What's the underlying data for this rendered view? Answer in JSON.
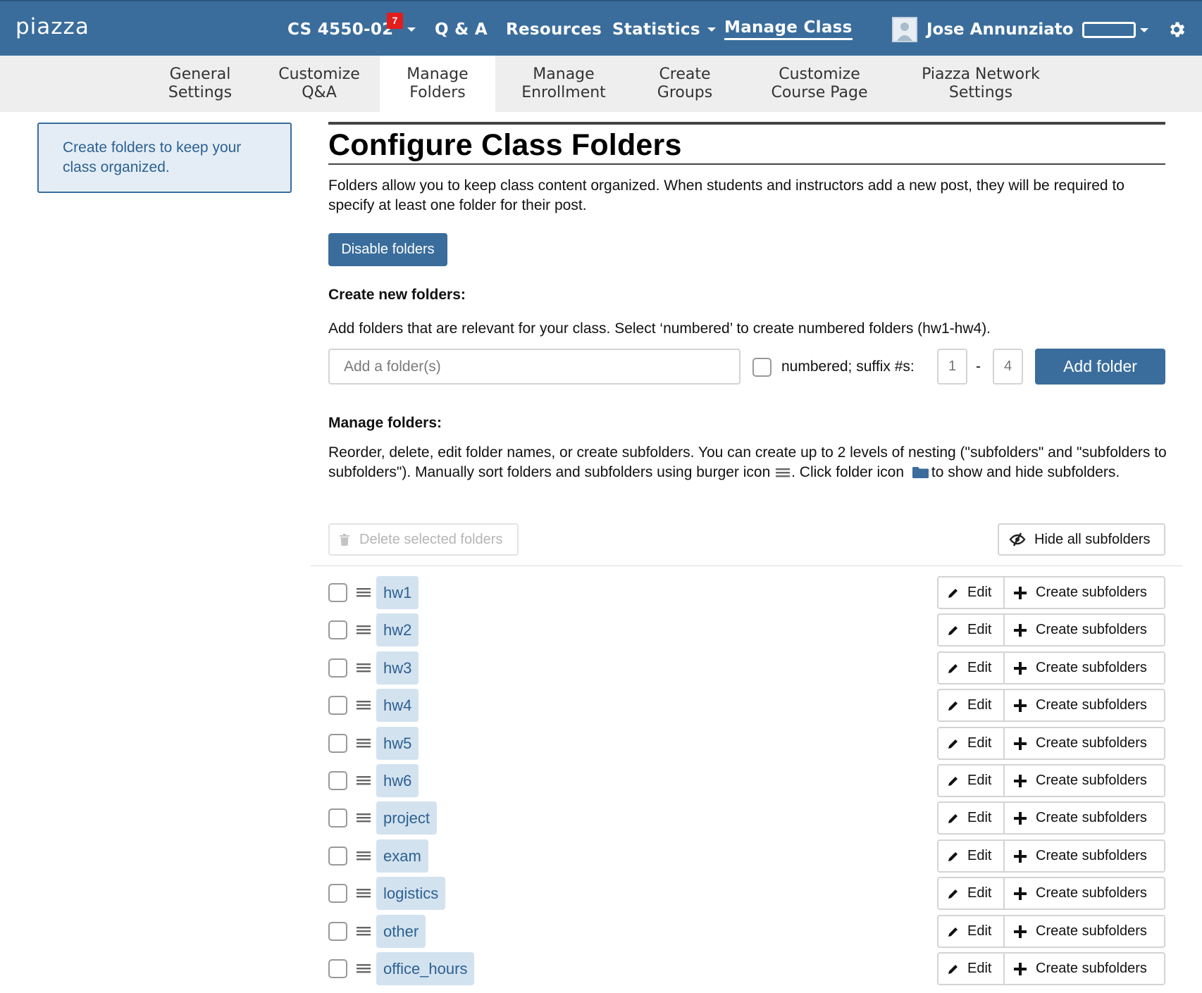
{
  "topbar": {
    "logo": "piazza",
    "class_name": "CS 4550-02",
    "class_badge": "7",
    "nav": {
      "qa": "Q & A",
      "resources": "Resources",
      "statistics": "Statistics",
      "manage_class": "Manage Class"
    },
    "user_name": "Jose Annunziato",
    "icons": [
      "caret-down-icon",
      "avatar-icon",
      "gear-icon"
    ]
  },
  "subnav": {
    "tabs": [
      {
        "line1": "General",
        "line2": "Settings",
        "active": false
      },
      {
        "line1": "Customize",
        "line2": "Q&A",
        "active": false
      },
      {
        "line1": "Manage",
        "line2": "Folders",
        "active": true
      },
      {
        "line1": "Manage",
        "line2": "Enrollment",
        "active": false
      },
      {
        "line1": "Create",
        "line2": "Groups",
        "active": false
      },
      {
        "line1": "Customize",
        "line2": "Course Page",
        "active": false
      },
      {
        "line1": "Piazza Network",
        "line2": "Settings",
        "active": false
      }
    ]
  },
  "sidebar": {
    "note": "Create folders to keep your class organized."
  },
  "main": {
    "title": "Configure Class Folders",
    "intro": "Folders allow you to keep class content organized. When students and instructors add a new post, they will be required to specify at least one folder for their post.",
    "disable_button": "Disable folders",
    "create": {
      "heading": "Create new folders:",
      "description": "Add folders that are relevant for your class. Select ‘numbered’ to create numbered folders (hw1-hw4).",
      "input_placeholder": "Add a folder(s)",
      "numbered_label": "numbered; suffix #s:",
      "suffix_from": "1",
      "suffix_dash": "-",
      "suffix_to": "4",
      "add_button": "Add folder"
    },
    "manage": {
      "heading": "Manage folders:",
      "desc_part1": "Reorder, delete, edit folder names, or create subfolders. You can create up to 2 levels of nesting (\"subfolders\" and \"subfolders to subfolders\"). Manually sort folders and subfolders using burger icon",
      "desc_part2": ". Click folder icon",
      "desc_part3": "to show and hide subfolders.",
      "delete_button": "Delete selected folders",
      "hide_button": "Hide all subfolders",
      "edit_label": "Edit",
      "create_sub_label": "Create subfolders"
    },
    "folders": [
      "hw1",
      "hw2",
      "hw3",
      "hw4",
      "hw5",
      "hw6",
      "project",
      "exam",
      "logistics",
      "other",
      "office_hours"
    ]
  },
  "colors": {
    "brand": "#3a6d9c",
    "chip_bg": "#d3e2ef",
    "chip_text": "#2d6192",
    "badge": "#e31c1c"
  }
}
